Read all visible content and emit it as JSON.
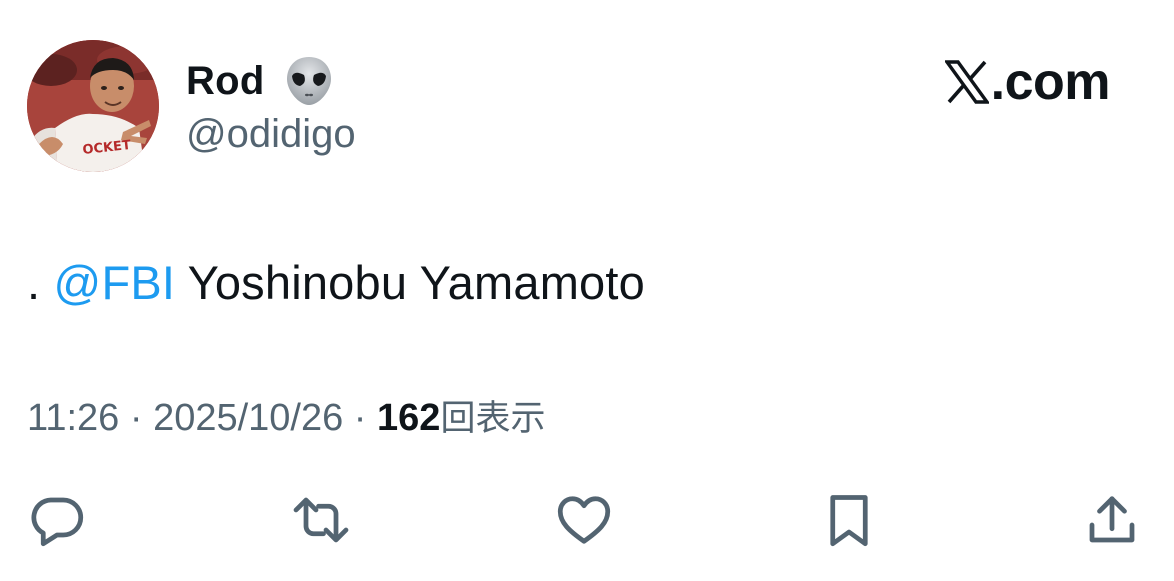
{
  "author": {
    "display_name": "Rod",
    "handle": "@odidigo",
    "avatar_icon": "profile-photo",
    "badge_icon": "alien-emoji"
  },
  "brand": {
    "text": ".com",
    "logo_icon": "x-logo-icon"
  },
  "tweet": {
    "prefix": ". ",
    "mention": "@FBI",
    "body": " Yoshinobu Yamamoto"
  },
  "meta": {
    "time": "11:26",
    "separator1": " · ",
    "date": "2025/10/26",
    "separator2": " · ",
    "views_count": "162",
    "views_label": "回表示"
  },
  "actions": [
    {
      "icon": "reply-icon"
    },
    {
      "icon": "repost-icon"
    },
    {
      "icon": "like-icon"
    },
    {
      "icon": "bookmark-icon"
    },
    {
      "icon": "share-icon"
    }
  ],
  "colors": {
    "text": "#0f1419",
    "secondary": "#536471",
    "mention": "#1d9bf0",
    "icon": "#536471"
  }
}
